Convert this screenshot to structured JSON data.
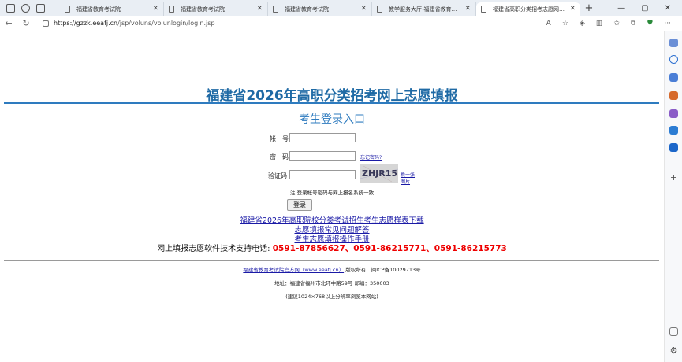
{
  "browser": {
    "tabs": [
      {
        "label": "福建省教育考试院",
        "active": false
      },
      {
        "label": "福建省教育考试院",
        "active": false
      },
      {
        "label": "福建省教育考试院",
        "active": false
      },
      {
        "label": "教学服务大厅-福建省教育考试院",
        "active": false
      },
      {
        "label": "福建省高职分类招考志愿网上填",
        "active": true
      }
    ],
    "new_tab": "+",
    "url_host": "https://gzzk.eeafj.cn",
    "url_path": "/jsp/voluns/volunlogin/login.jsp"
  },
  "page": {
    "title": "福建省2026年高职分类招考网上志愿填报",
    "subtitle": "考生登录入口",
    "account_label": "帐　号",
    "password_label": "密　码",
    "forgot_password": "忘记密码?",
    "captcha_label": "验证码",
    "captcha_text": "ZHJR15",
    "refresh_captcha_line1": "换一张",
    "refresh_captcha_line2": "图片",
    "note": "注:登录帐号密码与网上报名系统一致",
    "login_button": "登录",
    "links": [
      "福建省2026年高职院校分类考试招生考生志愿样表下载",
      "志愿填报常见问题解答",
      "考生志愿填报操作手册"
    ],
    "support_label": "网上填报志愿软件技术支持电话:",
    "support_phones": "0591-87856627、0591-86215771、0591-86215773",
    "footer_site": "福建省教育考试院官方网（www.eeafj.cn）",
    "footer_rights": "版权所有　闽ICP备10029713号",
    "footer_address": "地址：福建省福州市北环中路59号 邮编：350003",
    "footer_tip": "(建议1024×768以上分辨率浏览本网站)"
  },
  "colors": {
    "title": "#1f6aa5",
    "rule": "#2e7bbf",
    "link": "#1a1aa6",
    "phone": "#e00000"
  }
}
